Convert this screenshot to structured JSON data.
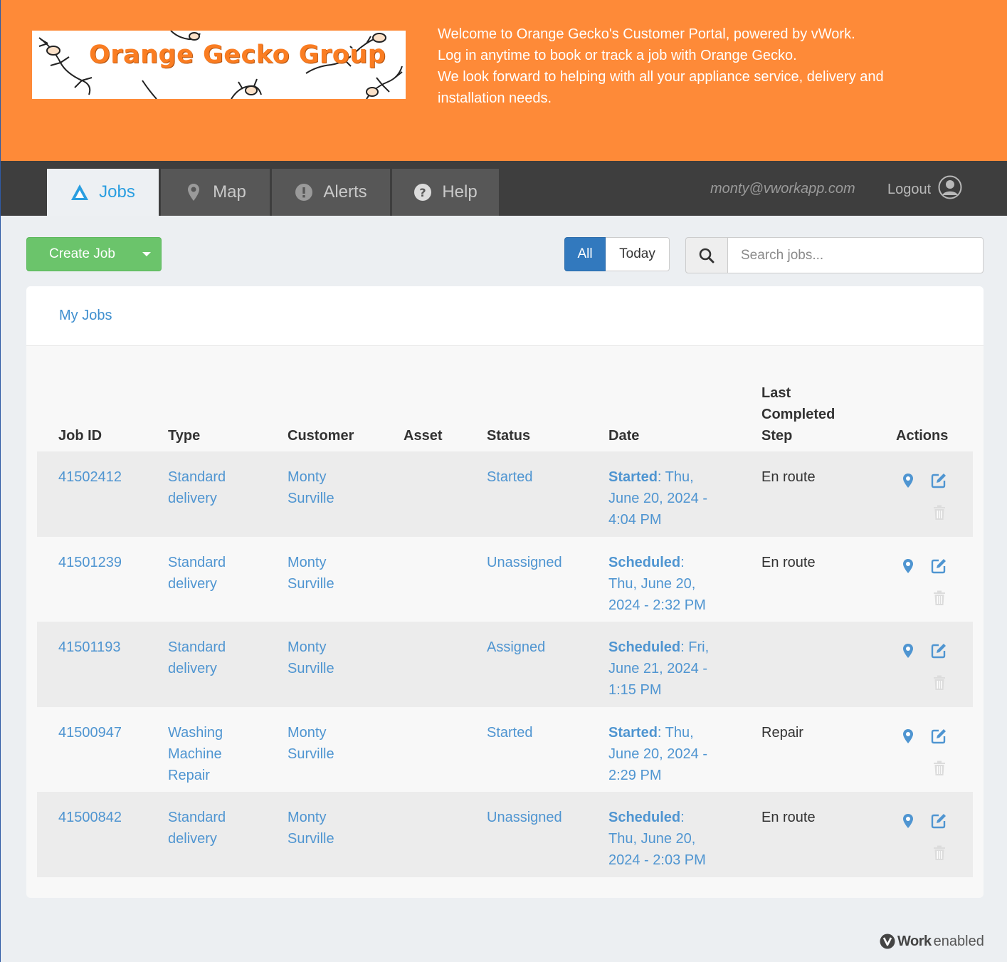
{
  "header": {
    "logo_text": "Orange Gecko Group",
    "welcome_lines": [
      "Welcome to Orange Gecko's Customer Portal, powered by vWork.",
      "Log in anytime to book or track a job with Orange Gecko.",
      "We look forward to helping with all your appliance service, delivery and",
      "installation needs."
    ],
    "brand_color": "#fe8a38"
  },
  "nav": {
    "tabs": [
      {
        "label": "Jobs",
        "icon": "warning-triangle-icon",
        "active": true
      },
      {
        "label": "Map",
        "icon": "map-marker-icon",
        "active": false
      },
      {
        "label": "Alerts",
        "icon": "exclamation-circle-icon",
        "active": false
      },
      {
        "label": "Help",
        "icon": "question-circle-icon",
        "active": false
      }
    ],
    "user_email": "monty@vworkapp.com",
    "logout_label": "Logout"
  },
  "toolbar": {
    "create_job_label": "Create Job",
    "filter_all_label": "All",
    "filter_today_label": "Today",
    "active_filter": "All",
    "search_placeholder": "Search jobs..."
  },
  "panel": {
    "title": "My Jobs"
  },
  "table": {
    "headers": {
      "job_id": "Job ID",
      "type": "Type",
      "customer": "Customer",
      "asset": "Asset",
      "status": "Status",
      "date": "Date",
      "last_step_1": "Last",
      "last_step_2": "Completed",
      "last_step_3": "Step",
      "actions": "Actions"
    },
    "rows": [
      {
        "job_id": "41502412",
        "type_1": "Standard",
        "type_2": "delivery",
        "type_3": "",
        "customer_1": "Monty",
        "customer_2": "Surville",
        "asset": "",
        "status": "Started",
        "date_label": "Started",
        "date_line1": ": Thu,",
        "date_line2": "June 20, 2024 -",
        "date_line3": "4:04 PM",
        "last_step": "En route"
      },
      {
        "job_id": "41501239",
        "type_1": "Standard",
        "type_2": "delivery",
        "type_3": "",
        "customer_1": "Monty",
        "customer_2": "Surville",
        "asset": "",
        "status": "Unassigned",
        "date_label": "Scheduled",
        "date_line1": ":",
        "date_line2": "Thu, June 20,",
        "date_line3": "2024 - 2:32 PM",
        "last_step": "En route"
      },
      {
        "job_id": "41501193",
        "type_1": "Standard",
        "type_2": "delivery",
        "type_3": "",
        "customer_1": "Monty",
        "customer_2": "Surville",
        "asset": "",
        "status": "Assigned",
        "date_label": "Scheduled",
        "date_line1": ": Fri,",
        "date_line2": "June 21, 2024 -",
        "date_line3": "1:15 PM",
        "last_step": ""
      },
      {
        "job_id": "41500947",
        "type_1": "Washing",
        "type_2": "Machine",
        "type_3": "Repair",
        "customer_1": "Monty",
        "customer_2": "Surville",
        "asset": "",
        "status": "Started",
        "date_label": "Started",
        "date_line1": ": Thu,",
        "date_line2": "June 20, 2024 -",
        "date_line3": "2:29 PM",
        "last_step": "Repair"
      },
      {
        "job_id": "41500842",
        "type_1": "Standard",
        "type_2": "delivery",
        "type_3": "",
        "customer_1": "Monty",
        "customer_2": "Surville",
        "asset": "",
        "status": "Unassigned",
        "date_label": "Scheduled",
        "date_line1": ":",
        "date_line2": "Thu, June 20,",
        "date_line3": "2024 - 2:03 PM",
        "last_step": "En route"
      }
    ],
    "row_actions": [
      "map-marker-icon",
      "edit-icon",
      "trash-icon"
    ]
  },
  "footer": {
    "brand_bold": "Work",
    "brand_rest": "enabled",
    "brand_icon": "vwork-logo-icon"
  },
  "colors": {
    "link_blue": "#4f95d1",
    "create_green": "#6bc46b",
    "filter_blue": "#3279be",
    "nav_dark": "#3e3e3e"
  }
}
